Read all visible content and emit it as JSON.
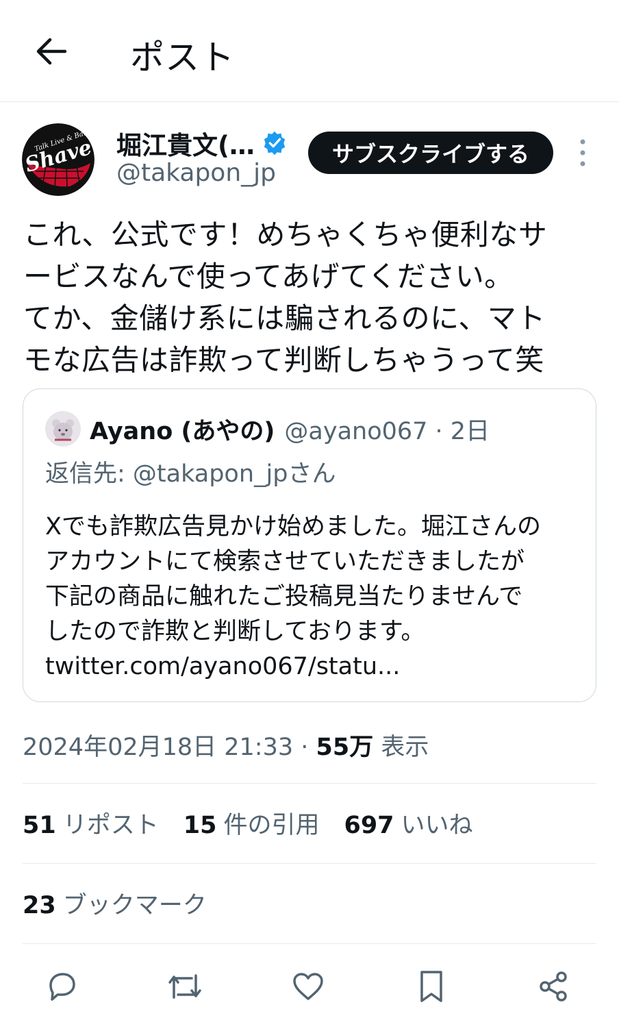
{
  "header": {
    "title": "ポスト"
  },
  "tweet": {
    "author_name": "堀江貴文(…",
    "author_handle": "@takapon_jp",
    "subscribe_label": "サブスクライブする",
    "text": "これ、公式です！めちゃくちゃ便利なサ\nービスなんで使ってあげてください。\nてか、金儲け系には騙されるのに、マト\nモな広告は詐欺って判断しちゃうって笑",
    "avatar_text": "Shave",
    "avatar_small_text": "Talk Live & Bar"
  },
  "quote": {
    "name": "Ayano (あやの)",
    "handle": "@ayano067 · 2日",
    "reply_to": "返信先: @takapon_jpさん",
    "text": "Xでも詐欺広告見かけ始めました。堀江さんの\nアカウントにて検索させていただきましたが\n下記の商品に触れたご投稿見当たりませんで\nしたので詐欺と判断しております。\ntwitter.com/ayano067/statu..."
  },
  "meta": {
    "timestamp": "2024年02月18日 21:33 · ",
    "views_count": "55万",
    "views_label": " 表示"
  },
  "stats": {
    "reposts_count": "51",
    "reposts_label": "リポスト",
    "quotes_count": "15",
    "quotes_label": "件の引用",
    "likes_count": "697",
    "likes_label": "いいね",
    "bookmarks_count": "23",
    "bookmarks_label": "ブックマーク"
  },
  "colors": {
    "accent": "#1d9bf0",
    "text": "#0f1419",
    "secondary": "#536471",
    "border": "#cfd9de"
  }
}
